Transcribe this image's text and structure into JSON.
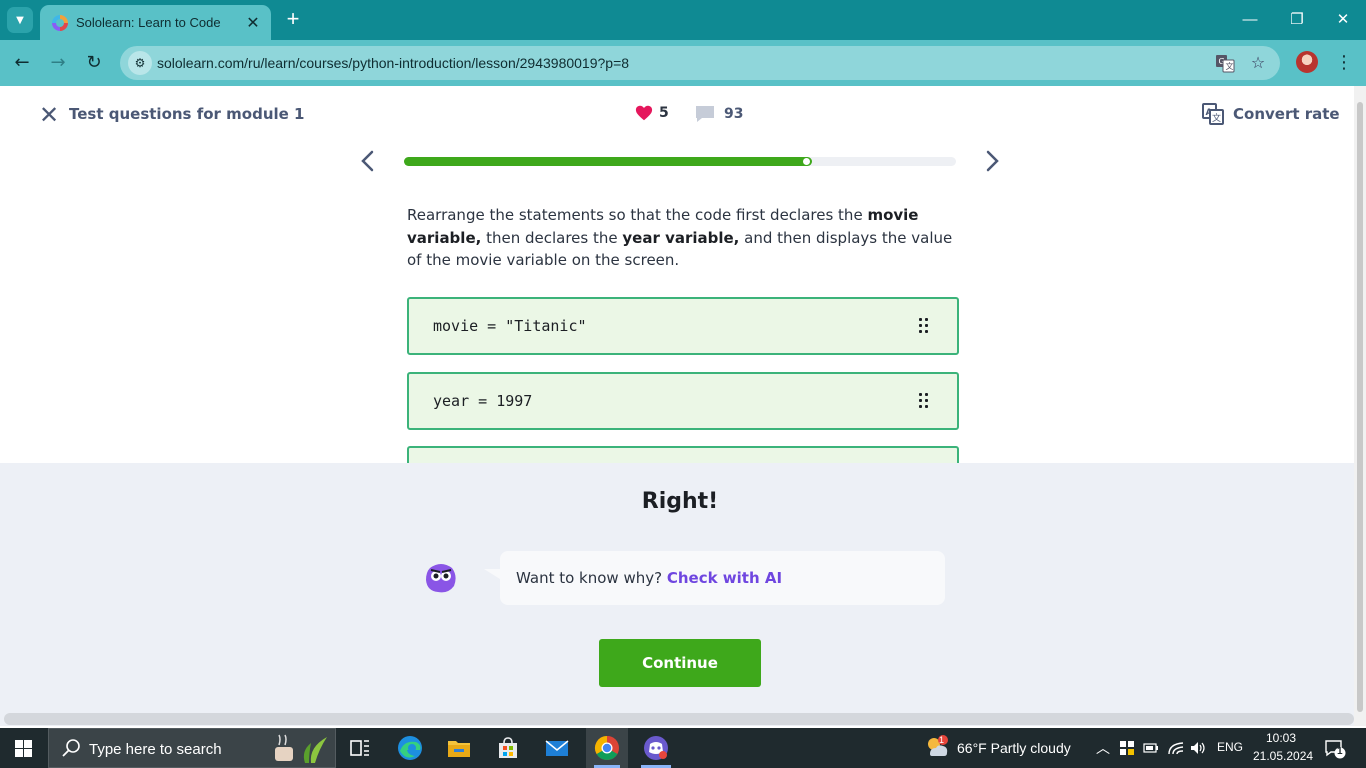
{
  "browser": {
    "tab_title": "Sololearn: Learn to Code",
    "url": "sololearn.com/ru/learn/courses/python-introduction/lesson/2943980019?p=8"
  },
  "header": {
    "lesson_title": "Test questions for module 1",
    "hearts": "5",
    "comments": "93",
    "convert_label": "Convert rate"
  },
  "progress": {
    "fraction": 0.74
  },
  "question": {
    "part1": "Rearrange the statements so that the code first declares the ",
    "bold1": "movie variable,",
    "part2": " then declares the ",
    "bold2": "year variable,",
    "part3": " and then displays the value of the movie variable on the screen."
  },
  "code_blocks": [
    {
      "text": "movie = \"Titanic\""
    },
    {
      "text": "year = 1997"
    }
  ],
  "result": {
    "title": "Right!",
    "prompt": "Want to know why? ",
    "link": "Check with AI",
    "continue_label": "Continue"
  },
  "taskbar": {
    "search_placeholder": "Type here to search",
    "weather": "66°F  Partly cloudy",
    "language": "ENG",
    "time": "10:03",
    "date": "21.05.2024",
    "weather_badge": "1",
    "notification_count": "1"
  },
  "colors": {
    "accent_green": "#3ea81b",
    "ai_purple": "#6f46e0",
    "chrome_teal": "#59c1c7"
  }
}
